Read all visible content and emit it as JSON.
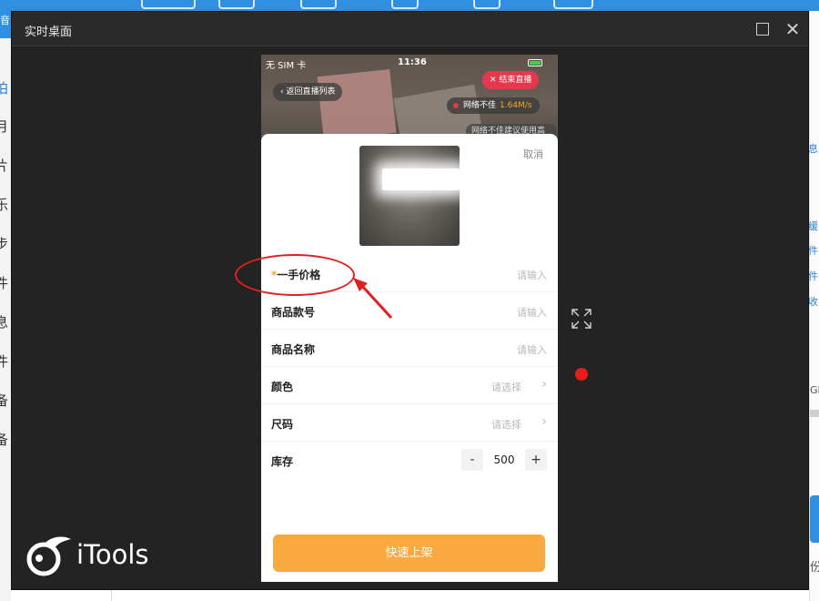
{
  "window": {
    "title": "实时桌面",
    "maximize_icon": "maximize-icon",
    "close_icon": "close-icon"
  },
  "background_app": {
    "left_labels": [
      "拍",
      "片",
      "月",
      "乐",
      "步",
      "件",
      "息",
      "件",
      "备",
      "备"
    ],
    "right_labels": [
      "息",
      "缓",
      "件",
      "件",
      "收",
      "GB",
      "份"
    ]
  },
  "phone": {
    "status": {
      "carrier": "无 SIM 卡",
      "time": "11:36"
    },
    "back_button": "返回直播列表",
    "end_live_button": "结束直播",
    "network": {
      "label": "网络不佳",
      "speed": "1.64M/s"
    },
    "network_tip": "网络不佳建议使用高"
  },
  "sheet": {
    "cancel": "取消",
    "fields": [
      {
        "label": "一手价格",
        "required": true,
        "placeholder": "请输入"
      },
      {
        "label": "商品款号",
        "placeholder": "请输入"
      },
      {
        "label": "商品名称",
        "placeholder": "请输入"
      },
      {
        "label": "颜色",
        "placeholder": "请选择"
      },
      {
        "label": "尺码",
        "placeholder": "请选择"
      }
    ],
    "stock": {
      "label": "库存",
      "minus": "-",
      "value": "500",
      "plus": "+"
    },
    "submit": "快速上架"
  },
  "logo": {
    "text": "iTools"
  },
  "colors": {
    "accent_orange": "#f9a940",
    "annotation_red": "#e02020",
    "end_live_red": "#e6384d",
    "app_blue": "#2f8fe0"
  }
}
